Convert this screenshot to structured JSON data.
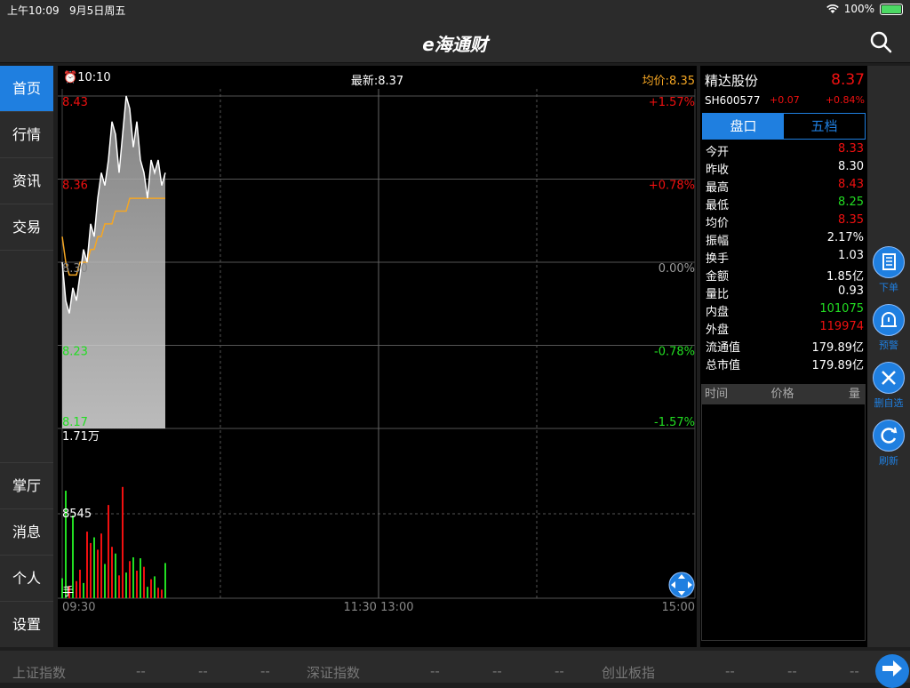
{
  "status": {
    "time": "上午10:09",
    "date": "9月5日周五",
    "battery": "100%"
  },
  "app": {
    "logo": "e海通财"
  },
  "sidebar": {
    "top": [
      {
        "label": "首页"
      },
      {
        "label": "行情"
      },
      {
        "label": "资讯"
      },
      {
        "label": "交易"
      }
    ],
    "bottom": [
      {
        "label": "掌厅"
      },
      {
        "label": "消息"
      },
      {
        "label": "个人"
      },
      {
        "label": "设置"
      }
    ]
  },
  "chart_header": {
    "time": "10:10",
    "latest": "最新:8.37",
    "avg": "均价:8.35"
  },
  "chart_data": {
    "type": "line",
    "price_labels": [
      "8.43",
      "8.36",
      "8.30",
      "8.23",
      "8.17"
    ],
    "pct_labels": [
      "+1.57%",
      "+0.78%",
      "0.00%",
      "-0.78%",
      "-1.57%"
    ],
    "ylim": [
      8.17,
      8.43
    ],
    "x_ticks": [
      "09:30",
      "11:30 13:00",
      "15:00"
    ],
    "volume_labels": [
      "1.71万",
      "8545"
    ],
    "volume_unit": "手",
    "volume_max": 17100,
    "series": [
      {
        "values": [
          8.3,
          8.27,
          8.26,
          8.28,
          8.27,
          8.29,
          8.31,
          8.3,
          8.33,
          8.32,
          8.35,
          8.37,
          8.36,
          8.38,
          8.41,
          8.4,
          8.37,
          8.4,
          8.43,
          8.42,
          8.39,
          8.41,
          8.38,
          8.37,
          8.35,
          8.38,
          8.37,
          8.38,
          8.36,
          8.37
        ]
      },
      {
        "values": [
          8.32,
          8.3,
          8.29,
          8.29,
          8.29,
          8.3,
          8.3,
          8.3,
          8.31,
          8.31,
          8.32,
          8.32,
          8.33,
          8.33,
          8.33,
          8.34,
          8.34,
          8.34,
          8.34,
          8.35,
          8.35,
          8.35,
          8.35,
          8.35,
          8.35,
          8.35,
          8.35,
          8.35,
          8.35,
          8.35
        ]
      }
    ],
    "volumes": [
      2100,
      11300,
      1300,
      8700,
      1800,
      3000,
      1600,
      7000,
      5800,
      6400,
      5100,
      6800,
      3600,
      9800,
      5400,
      4700,
      2400,
      11700,
      2700,
      3900,
      4300,
      2900,
      4200,
      3300,
      1200,
      2000,
      2300,
      1100,
      900,
      3700
    ],
    "volume_colors": [
      "green",
      "green",
      "red",
      "green",
      "red",
      "red",
      "green",
      "red",
      "red",
      "green",
      "red",
      "red",
      "green",
      "red",
      "red",
      "green",
      "red",
      "red",
      "green",
      "red",
      "green",
      "red",
      "green",
      "red",
      "green",
      "red",
      "green",
      "red",
      "red",
      "green"
    ]
  },
  "stock": {
    "name": "精达股份",
    "price": "8.37",
    "code": "SH600577",
    "change": "+0.07",
    "pct": "+0.84%"
  },
  "tabs": [
    {
      "label": "盘口"
    },
    {
      "label": "五档"
    }
  ],
  "quote_rows": [
    {
      "label": "今开",
      "value": "8.33",
      "color": "#f01010"
    },
    {
      "label": "昨收",
      "value": "8.30",
      "color": "#ffffff"
    },
    {
      "label": "最高",
      "value": "8.43",
      "color": "#f01010"
    },
    {
      "label": "最低",
      "value": "8.25",
      "color": "#22dd22"
    },
    {
      "label": "均价",
      "value": "8.35",
      "color": "#f01010"
    },
    {
      "label": "振幅",
      "value": "2.17%",
      "color": "#ffffff"
    },
    {
      "label": "换手",
      "value": "1.03",
      "color": "#ffffff"
    },
    {
      "label": "金额",
      "value": "1.85亿",
      "color": "#ffffff"
    },
    {
      "label": "量比",
      "value": "0.93",
      "color": "#ffffff"
    },
    {
      "label": "内盘",
      "value": "101075",
      "color": "#22dd22"
    },
    {
      "label": "外盘",
      "value": "119974",
      "color": "#f01010"
    },
    {
      "label": "流通值",
      "value": "179.89亿",
      "color": "#ffffff"
    },
    {
      "label": "总市值",
      "value": "179.89亿",
      "color": "#ffffff"
    }
  ],
  "trade_head": {
    "time": "时间",
    "price": "价格",
    "qty": "量"
  },
  "float_buttons": [
    {
      "label": "下单"
    },
    {
      "label": "预警"
    },
    {
      "label": "删自选"
    },
    {
      "label": "刷新"
    }
  ],
  "bottom_indices": [
    {
      "name": "上证指数",
      "v1": "--",
      "v2": "--",
      "v3": "--"
    },
    {
      "name": "深证指数",
      "v1": "--",
      "v2": "--",
      "v3": "--"
    },
    {
      "name": "创业板指",
      "v1": "--",
      "v2": "--",
      "v3": "--"
    }
  ],
  "colors": {
    "accent": "#1f7fe0",
    "up": "#f01010",
    "down": "#22dd22",
    "avg": "#f5a623"
  }
}
